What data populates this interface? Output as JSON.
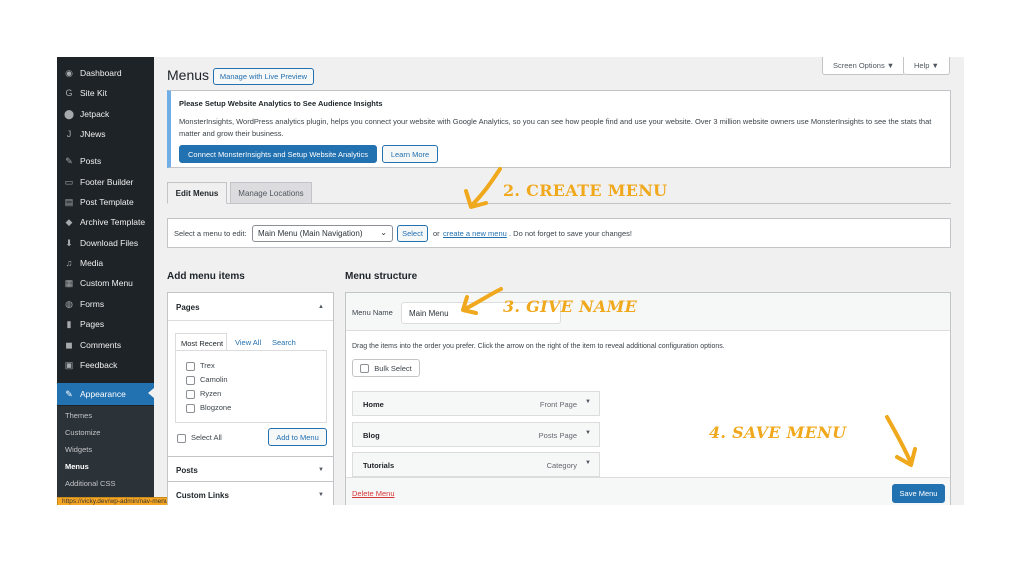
{
  "sidebar": {
    "items": [
      {
        "label": "Dashboard",
        "icon": "dashboard-icon",
        "glyph": "◉"
      },
      {
        "label": "Site Kit",
        "icon": "site-kit-icon",
        "glyph": "G"
      },
      {
        "label": "Jetpack",
        "icon": "jetpack-icon",
        "glyph": "⬤"
      },
      {
        "label": "JNews",
        "icon": "jnews-icon",
        "glyph": "J"
      },
      {
        "label": "Posts",
        "icon": "pin-icon",
        "glyph": "✎"
      },
      {
        "label": "Footer Builder",
        "icon": "footer-icon",
        "glyph": "▭"
      },
      {
        "label": "Post Template",
        "icon": "template-icon",
        "glyph": "▤"
      },
      {
        "label": "Archive Template",
        "icon": "archive-icon",
        "glyph": "◆"
      },
      {
        "label": "Download Files",
        "icon": "download-icon",
        "glyph": "⬇"
      },
      {
        "label": "Media",
        "icon": "media-icon",
        "glyph": "♫"
      },
      {
        "label": "Custom Menu",
        "icon": "custom-menu-icon",
        "glyph": "▦"
      },
      {
        "label": "Forms",
        "icon": "forms-icon",
        "glyph": "◍"
      },
      {
        "label": "Pages",
        "icon": "pages-icon",
        "glyph": "▮"
      },
      {
        "label": "Comments",
        "icon": "comments-icon",
        "glyph": "◼"
      },
      {
        "label": "Feedback",
        "icon": "feedback-icon",
        "glyph": "▣"
      },
      {
        "label": "Appearance",
        "icon": "appearance-icon",
        "glyph": "✎"
      }
    ],
    "submenu": [
      "Themes",
      "Customize",
      "Widgets",
      "Menus",
      "Additional CSS"
    ],
    "status_url": "https://vicky.dev/wp-admin/nav-menus.php?action=edit&menu=0"
  },
  "header": {
    "title": "Menus",
    "live_preview": "Manage with Live Preview",
    "screen_options": "Screen Options ▼",
    "help": "Help ▼"
  },
  "notice": {
    "title": "Please Setup Website Analytics to See Audience Insights",
    "body": "MonsterInsights, WordPress analytics plugin, helps you connect your website with Google Analytics, so you can see how people find and use your website. Over 3 million website owners use MonsterInsights to see the stats that matter and grow their business.",
    "connect_button": "Connect MonsterInsights and Setup Website Analytics",
    "learn_more": "Learn More"
  },
  "tabs": {
    "edit": "Edit Menus",
    "locations": "Manage Locations"
  },
  "select_bar": {
    "label": "Select a menu to edit:",
    "value": "Main Menu (Main Navigation)",
    "select_button": "Select",
    "or": "or",
    "create_link": "create a new menu",
    "suffix": ". Do not forget to save your changes!"
  },
  "add_items": {
    "heading": "Add menu items",
    "pages_title": "Pages",
    "subtabs": [
      "Most Recent",
      "View All",
      "Search"
    ],
    "pages": [
      "Trex",
      "Camolin",
      "Ryzen",
      "Blogzone"
    ],
    "select_all": "Select All",
    "add_button": "Add to Menu",
    "posts_title": "Posts",
    "custom_links_title": "Custom Links"
  },
  "structure": {
    "heading": "Menu structure",
    "name_label": "Menu Name",
    "name_value": "Main Menu",
    "instructions": "Drag the items into the order you prefer. Click the arrow on the right of the item to reveal additional configuration options.",
    "bulk_select": "Bulk Select",
    "items": [
      {
        "title": "Home",
        "type": "Front Page"
      },
      {
        "title": "Blog",
        "type": "Posts Page"
      },
      {
        "title": "Tutorials",
        "type": "Category"
      }
    ],
    "delete": "Delete Menu",
    "save": "Save Menu"
  },
  "annotations": {
    "create": "2. CREATE MENU",
    "name": "3. GIVE NAME",
    "save": "4. SAVE MENU",
    "color": "#f0a81c"
  }
}
